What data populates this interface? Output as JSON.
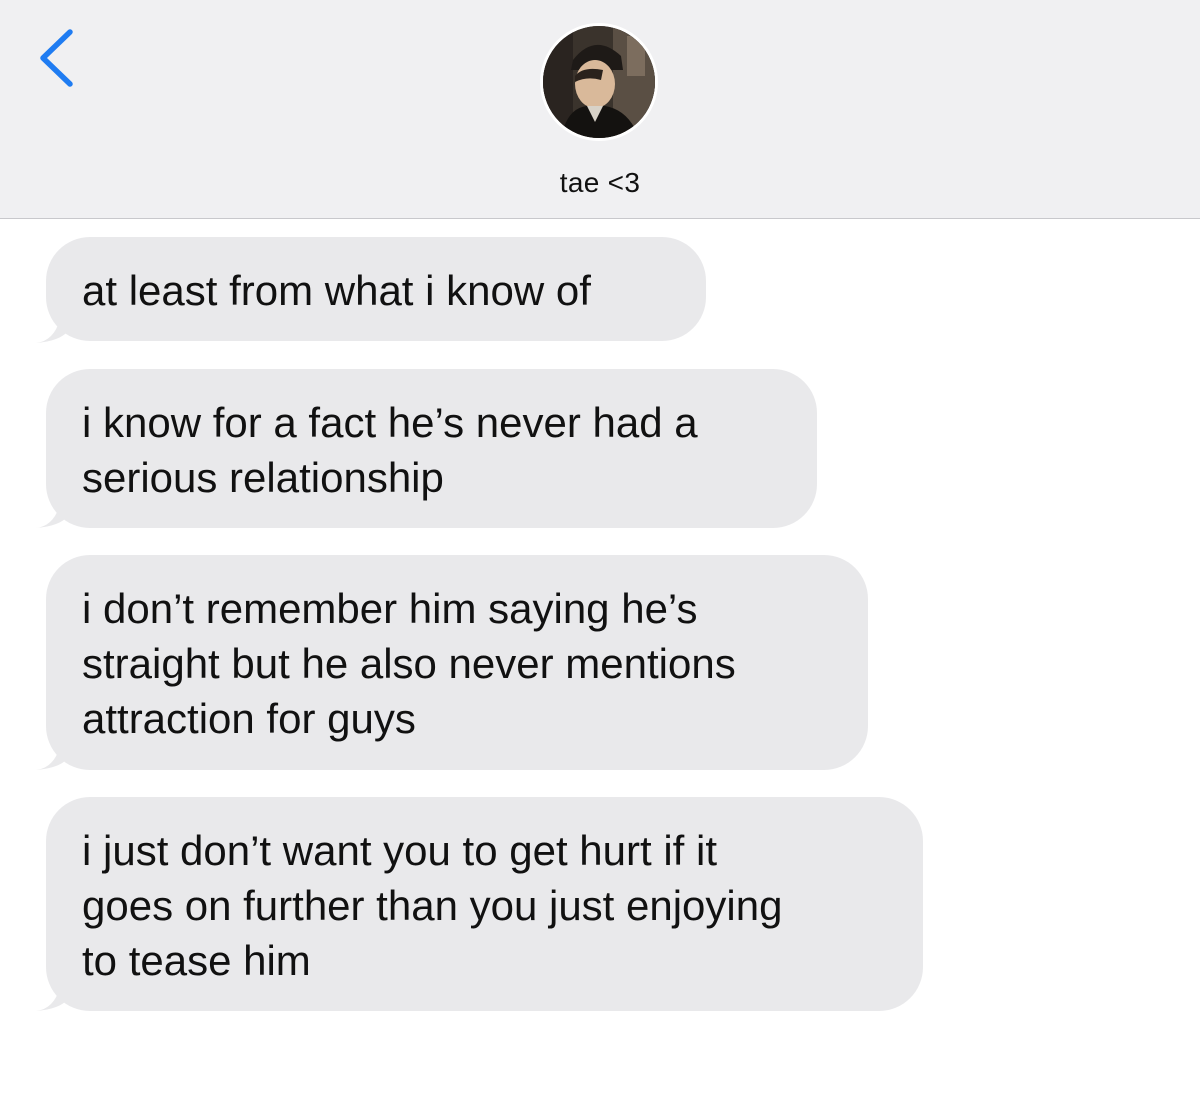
{
  "colors": {
    "header_bg": "#f0f0f2",
    "back_accent": "#1f7cf2",
    "bubble_bg": "#e9e9eb",
    "text": "#111111"
  },
  "header": {
    "back_icon": "chevron-left-icon",
    "avatar": "contact-photo",
    "contact_name": "tae <3"
  },
  "messages": [
    {
      "sender": "contact",
      "text": "at least from what i know of"
    },
    {
      "sender": "contact",
      "text": "i know for a fact he’s never had a\nserious relationship"
    },
    {
      "sender": "contact",
      "text": "i don’t remember him saying he’s\nstraight but he also never mentions\nattraction for guys"
    },
    {
      "sender": "contact",
      "text": "i just don’t want you to get hurt if it\ngoes on further than you just enjoying\nto tease him"
    }
  ]
}
